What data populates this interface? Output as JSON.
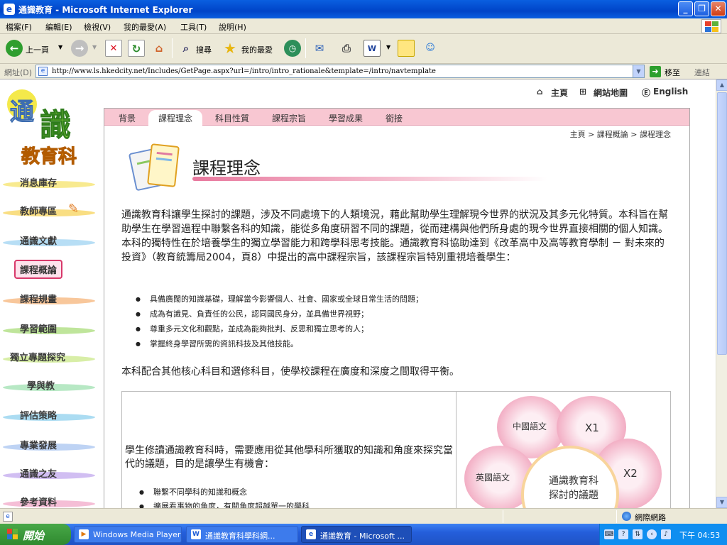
{
  "window": {
    "title": "通識教育 - Microsoft Internet Explorer"
  },
  "menu": [
    "檔案(F)",
    "編輯(E)",
    "檢視(V)",
    "我的最愛(A)",
    "工具(T)",
    "說明(H)"
  ],
  "toolbar": {
    "back": "上一頁",
    "search": "搜尋",
    "favorites": "我的最愛"
  },
  "address": {
    "label": "網址(D)",
    "url": "http://www.ls.hkedcity.net/Includes/GetPage.aspx?url=/intro/intro_rationale&template=/intro/navtemplate",
    "go": "移至",
    "links": "連結"
  },
  "logo": {
    "line1a": "通",
    "line1b": "識",
    "line2": "教育科"
  },
  "nav": [
    "消息庫存",
    "教師專區",
    "通識文獻",
    "課程概論",
    "課程規畫",
    "學習範圍",
    "獨立專題探究",
    "學與教",
    "評估策略",
    "專業發展",
    "通識之友",
    "參考資料"
  ],
  "utility": {
    "home": "主頁",
    "sitemap": "網站地圖",
    "english": "English"
  },
  "tabs": [
    "背景",
    "課程理念",
    "科目性質",
    "課程宗旨",
    "學習成果",
    "銜接"
  ],
  "breadcrumb": "主頁 > 課程概論 > 課程理念",
  "page_title": "課程理念",
  "intro_paragraph": "通識教育科讓學生探討的課題，涉及不同處境下的人類境況，藉此幫助學生理解現今世界的狀況及其多元化特質。本科旨在幫助學生在學習過程中聯繫各科的知識，能從多角度研習不同的課題，從而建構與他們所身處的現今世界直接相關的個人知識。本科的獨特性在於培養學生的獨立學習能力和跨學科思考技能。通識教育科協助達到《改革高中及高等教育學制 － 對未來的投資》（教育統籌局2004，頁8）中提出的高中課程宗旨，該課程宗旨特別重視培養學生：",
  "bullets": [
    "具備廣闊的知識基礎，理解當今影響個人、社會、國家或全球日常生活的問題；",
    "成為有識見、負責任的公民，認同國民身分，並具備世界視野；",
    "尊重多元文化和觀點，並成為能夠批判、反思和獨立思考的人；",
    "掌握終身學習所需的資訊科技及其他技能。"
  ],
  "balance_paragraph": "本科配合其他核心科目和選修科目，使學校課程在廣度和深度之間取得平衡。",
  "box": {
    "text": "學生修讀通識教育科時，需要應用從其他學科所獲取的知識和角度來探究當代的議題，目的是讓學生有機會：",
    "bullets": [
      "聯繫不同學科的知識和概念",
      "擴展看事物的角度，有關角度超越單一的學科"
    ]
  },
  "diagram": {
    "petals": [
      "中國語文",
      "X1",
      "英國語文",
      "X2"
    ],
    "center": [
      "通識教育科",
      "探討的議題"
    ]
  },
  "status": {
    "zone": "網際網路"
  },
  "taskbar": {
    "start": "開始",
    "tasks": [
      "Windows Media Player",
      "通識教育科學科網...",
      "通識教育 - Microsoft ..."
    ],
    "clock": "下午 04:53"
  },
  "colors": {
    "tabstrip": "#f8c7d2",
    "accent": "#e8799e",
    "xp_blue": "#245edb"
  }
}
